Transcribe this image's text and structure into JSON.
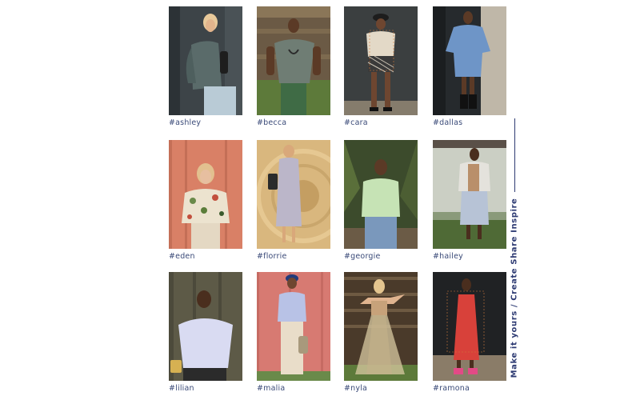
{
  "looks": [
    {
      "tag": "#ashley"
    },
    {
      "tag": "#becca"
    },
    {
      "tag": "#cara"
    },
    {
      "tag": "#dallas"
    },
    {
      "tag": "#eden"
    },
    {
      "tag": "#florrie"
    },
    {
      "tag": "#georgie"
    },
    {
      "tag": "#hailey"
    },
    {
      "tag": "#lilian"
    },
    {
      "tag": "#malia"
    },
    {
      "tag": "#nyla"
    },
    {
      "tag": "#ramona"
    }
  ],
  "tagline": "Make it yours / Create Share Inspire",
  "colors": {
    "accent_text": "#3a4a78",
    "tagline": "#2e3b73"
  }
}
